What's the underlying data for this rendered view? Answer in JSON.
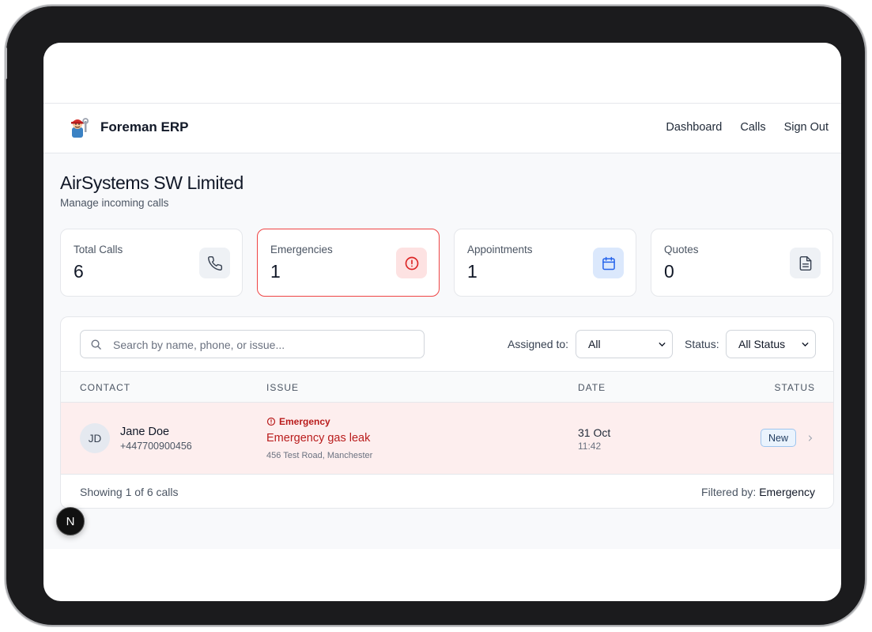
{
  "header": {
    "brand": "Foreman ERP",
    "logo_icon": "plumber-avatar-icon",
    "nav": [
      "Dashboard",
      "Calls",
      "Sign Out"
    ]
  },
  "page": {
    "title": "AirSystems SW Limited",
    "subtitle": "Manage incoming calls"
  },
  "stats": [
    {
      "label": "Total Calls",
      "value": "6",
      "icon": "phone-icon"
    },
    {
      "label": "Emergencies",
      "value": "1",
      "icon": "alert-circle-icon",
      "highlight": "#ef4444"
    },
    {
      "label": "Appointments",
      "value": "1",
      "icon": "calendar-icon"
    },
    {
      "label": "Quotes",
      "value": "0",
      "icon": "document-icon"
    }
  ],
  "filters": {
    "search_placeholder": "Search by name, phone, or issue...",
    "assigned_label": "Assigned to:",
    "assigned_value": "All",
    "status_label": "Status:",
    "status_value": "All Status"
  },
  "table": {
    "columns": [
      "CONTACT",
      "ISSUE",
      "DATE",
      "STATUS"
    ],
    "rows": [
      {
        "initials": "JD",
        "name": "Jane Doe",
        "phone": "+447700900456",
        "tag": "Emergency",
        "issue": "Emergency gas leak",
        "address": "456 Test Road, Manchester",
        "date": "31 Oct",
        "time": "11:42",
        "status": "New"
      }
    ]
  },
  "footer": {
    "showing": "Showing 1 of 6 calls",
    "filtered_label": "Filtered by:",
    "filtered_value": "Emergency"
  },
  "dev_button": "N",
  "colors": {
    "emergency": "#b91c1c",
    "emergency_row_bg": "#fdeeee",
    "accent_border": "#ef4444"
  }
}
